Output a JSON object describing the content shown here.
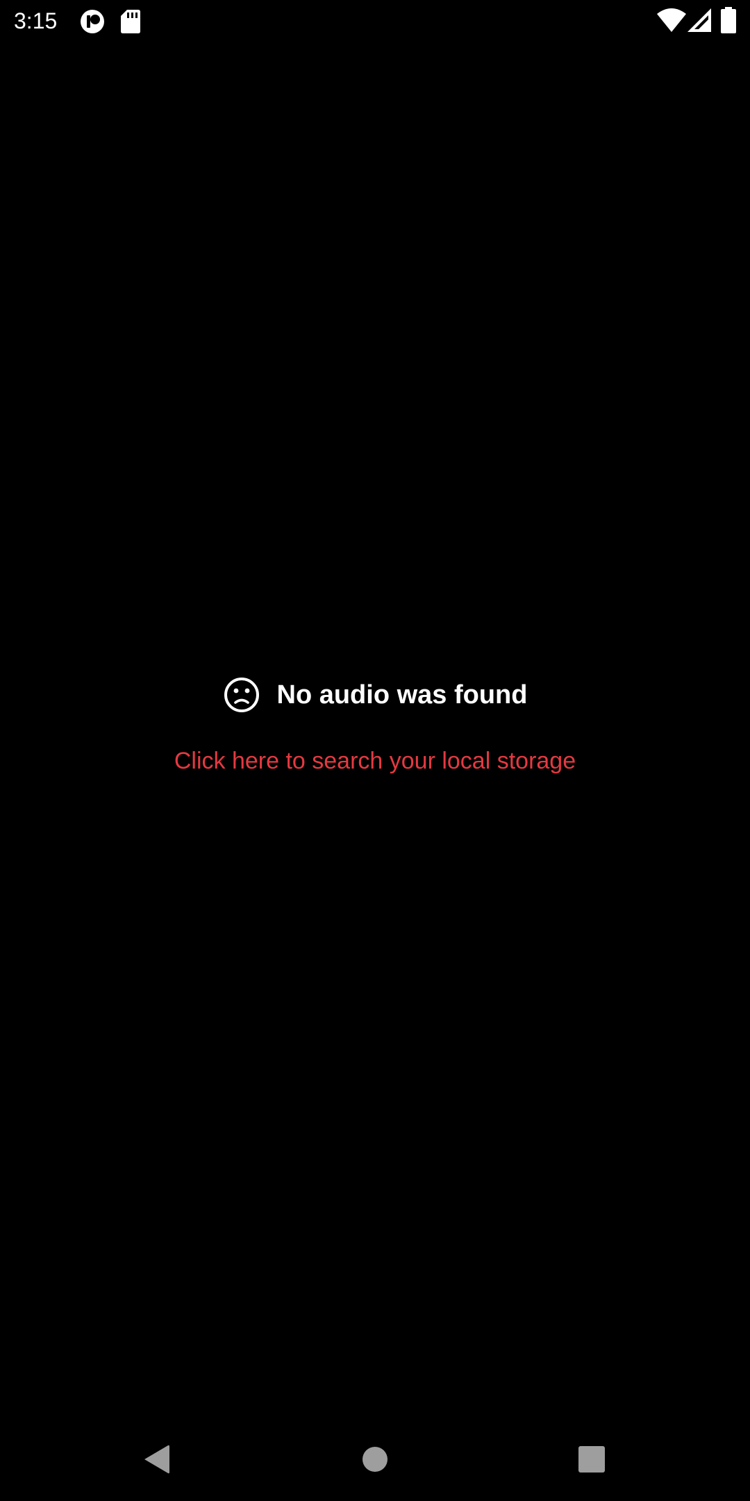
{
  "status_bar": {
    "time": "3:15",
    "icons": [
      "screen-record-icon",
      "sd-card-icon",
      "wifi-icon",
      "cell-signal-icon",
      "battery-icon"
    ]
  },
  "empty_state": {
    "icon": "sad-face-icon",
    "title": "No audio was found",
    "search_link": "Click here to search your local storage"
  },
  "nav_bar": {
    "icons": [
      "back-icon",
      "home-icon",
      "recents-icon"
    ]
  },
  "colors": {
    "background": "#000000",
    "text": "#ffffff",
    "accent": "#e53941",
    "nav_icon": "#9e9e9e"
  }
}
